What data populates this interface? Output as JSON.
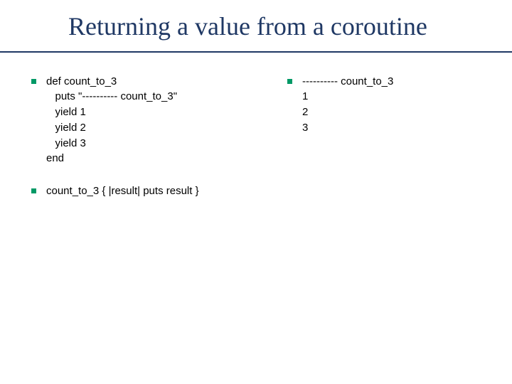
{
  "title": "Returning a value from a coroutine",
  "left": {
    "block1": "def count_to_3\n   puts \"---------- count_to_3\"\n   yield 1\n   yield 2\n   yield 3\nend",
    "block2": "count_to_3 { |result| puts result }"
  },
  "right": {
    "block1": "---------- count_to_3\n1\n2\n3"
  }
}
